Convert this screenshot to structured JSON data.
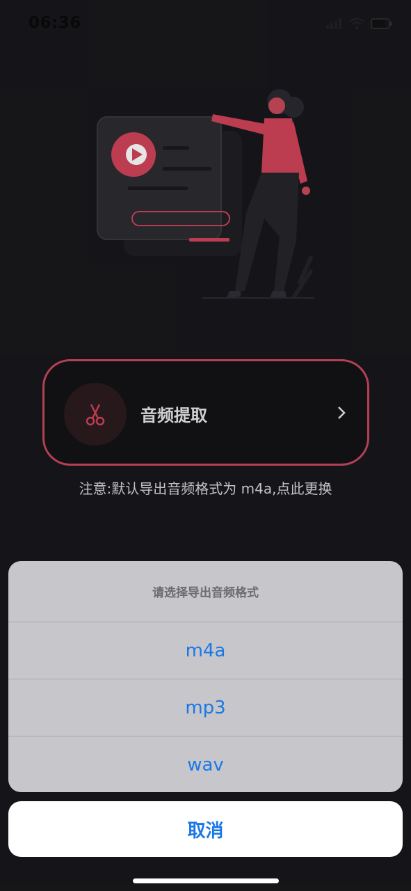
{
  "status_bar": {
    "time": "06:36"
  },
  "feature": {
    "title": "音频提取",
    "notice": "注意:默认导出音频格式为 m4a,点此更换"
  },
  "action_sheet": {
    "title": "请选择导出音频格式",
    "options": [
      "m4a",
      "mp3",
      "wav"
    ],
    "cancel": "取消"
  },
  "colors": {
    "accent": "#c9485f",
    "link_blue": "#1a78e6",
    "background": "#18181c"
  },
  "icons": [
    "signal-icon",
    "wifi-icon",
    "battery-icon",
    "scissors-icon",
    "chevron-right-icon",
    "play-icon"
  ]
}
